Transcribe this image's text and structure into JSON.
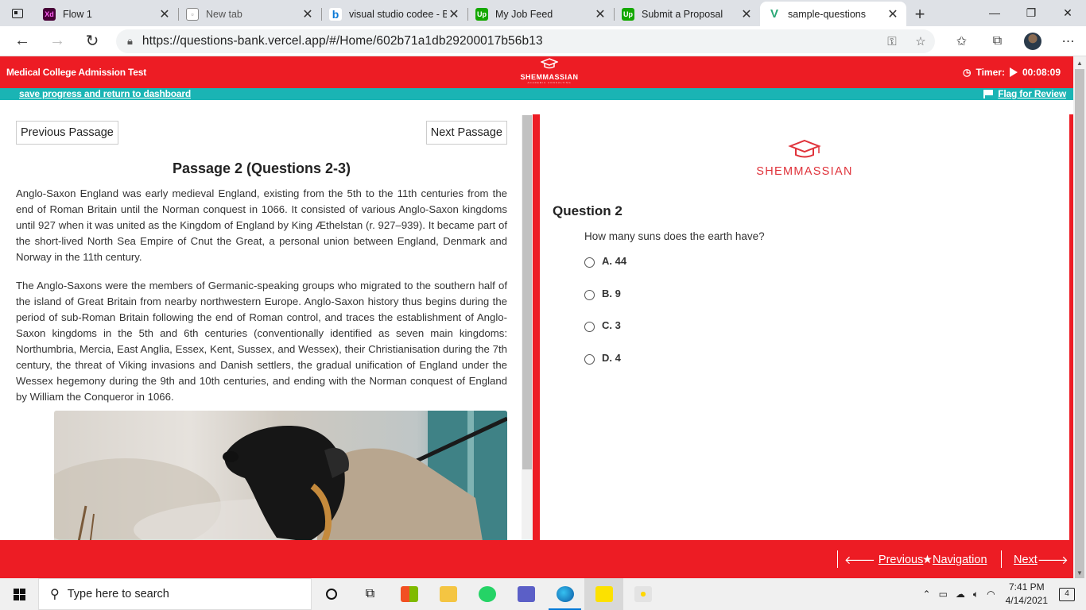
{
  "browser": {
    "tabs": [
      {
        "label": "Flow 1",
        "favicon": "xd-icon",
        "color": "#470137",
        "glyph": "Xd"
      },
      {
        "label": "New tab",
        "favicon": "newtab-icon",
        "color": "#ffffff",
        "glyph": ""
      },
      {
        "label": "visual studio codee - B",
        "favicon": "bing-icon",
        "color": "#ffffff",
        "glyph": "b"
      },
      {
        "label": "My Job Feed",
        "favicon": "upwork-icon",
        "color": "#14a800",
        "glyph": "Up"
      },
      {
        "label": "Submit a Proposal",
        "favicon": "upwork-icon",
        "color": "#14a800",
        "glyph": "Up"
      },
      {
        "label": "sample-questions",
        "favicon": "vue-icon",
        "color": "#ffffff",
        "glyph": "V"
      }
    ],
    "url": "https://questions-bank.vercel.app/#/Home/602b71a1db29200017b56b13"
  },
  "header": {
    "exam_title": "Medical College Admission Test",
    "brand": "SHEMMASSIAN",
    "tagline": "ACADEMIC CONSULTING",
    "timer_label": "Timer:",
    "timer_value": "00:08:09",
    "save_link": "save progress and return to dashboard",
    "flag_link": "Flag for Review"
  },
  "passage": {
    "prev_button": "Previous Passage",
    "next_button": "Next Passage",
    "title": "Passage 2 (Questions 2-3)",
    "paragraphs": [
      "Anglo-Saxon England was early medieval England, existing from the 5th to the 11th centuries from the end of Roman Britain until the Norman conquest in 1066. It consisted of various Anglo-Saxon kingdoms until 927 when it was united as the Kingdom of England by King Æthelstan (r. 927–939). It became part of the short-lived North Sea Empire of Cnut the Great, a personal union between England, Denmark and Norway in the 11th century.",
      "The Anglo-Saxons were the members of Germanic-speaking groups who migrated to the southern half of the island of Great Britain from nearby northwestern Europe. Anglo-Saxon history thus begins during the period of sub-Roman Britain following the end of Roman control, and traces the establishment of Anglo-Saxon kingdoms in the 5th and 6th centuries (conventionally identified as seven main kingdoms: Northumbria, Mercia, East Anglia, Essex, Kent, Sussex, and Wessex), their Christianisation during the 7th century, the threat of Viking invasions and Danish settlers, the gradual unification of England under the Wessex hegemony during the 9th and 10th centuries, and ending with the Norman conquest of England by William the Conqueror in 1066."
    ]
  },
  "question": {
    "brand": "SHEMMASSIAN",
    "title": "Question 2",
    "text": "How many suns does the earth have?",
    "options": [
      {
        "letter": "A.",
        "value": "44"
      },
      {
        "letter": "B.",
        "value": "9"
      },
      {
        "letter": "C.",
        "value": "3"
      },
      {
        "letter": "D.",
        "value": "4"
      }
    ]
  },
  "footer": {
    "previous": "Previous",
    "navigation": "Navigation",
    "next": "Next"
  },
  "taskbar": {
    "search_placeholder": "Type here to search",
    "time": "7:41 PM",
    "date": "4/14/2021",
    "notifications": "4"
  },
  "colors": {
    "brand_red": "#ed1c24",
    "teal": "#1ab4b4"
  }
}
